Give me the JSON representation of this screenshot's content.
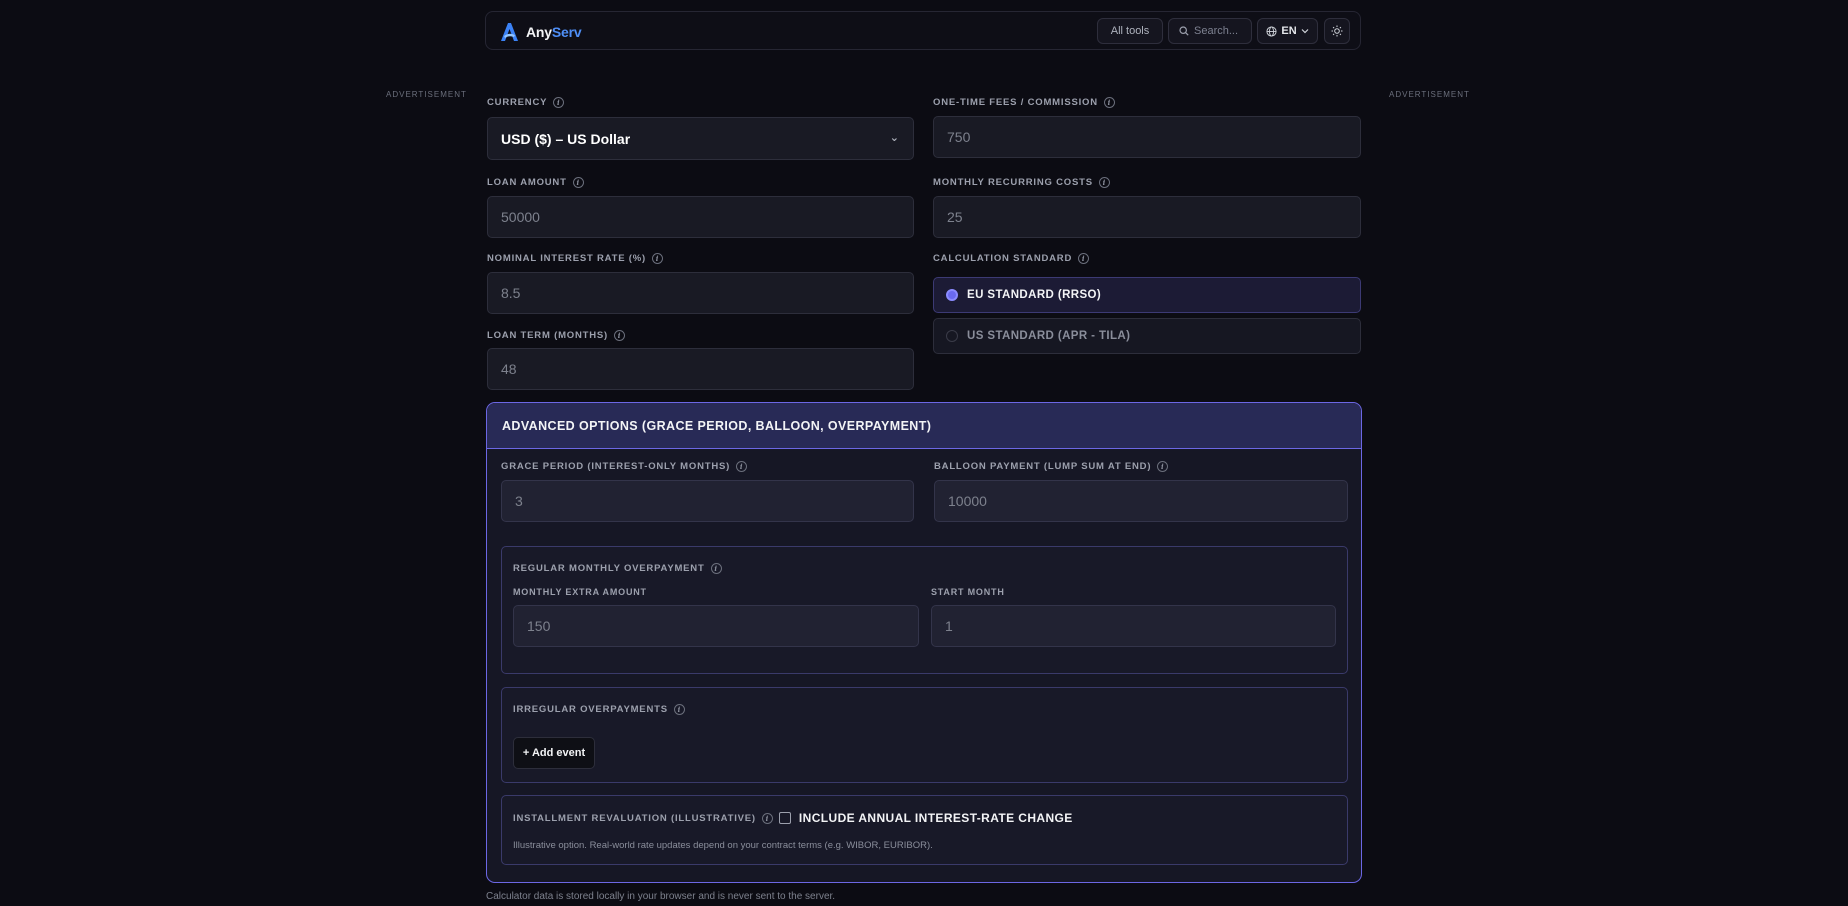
{
  "header": {
    "logo_part1": "Any",
    "logo_part2": "Serv",
    "all_tools": "All tools",
    "search_placeholder": "Search...",
    "language": "EN",
    "icons": [
      "logo-icon",
      "search-icon",
      "globe-icon",
      "chevron-down-icon",
      "sun-icon"
    ]
  },
  "ads": {
    "left": "ADVERTISEMENT",
    "right": "ADVERTISEMENT"
  },
  "form": {
    "currency": {
      "label": "CURRENCY",
      "value": "USD ($) – US Dollar"
    },
    "fees": {
      "label": "ONE-TIME FEES / COMMISSION",
      "placeholder": "750"
    },
    "loan_amount": {
      "label": "LOAN AMOUNT",
      "placeholder": "50000"
    },
    "recurring": {
      "label": "MONTHLY RECURRING COSTS",
      "placeholder": "25"
    },
    "rate": {
      "label": "NOMINAL INTEREST RATE (%)",
      "placeholder": "8.5"
    },
    "standard": {
      "label": "CALCULATION STANDARD",
      "options": [
        "EU STANDARD (RRSO)",
        "US STANDARD (APR - TILA)"
      ],
      "selected": "EU STANDARD (RRSO)"
    },
    "term": {
      "label": "LOAN TERM (MONTHS)",
      "placeholder": "48"
    }
  },
  "advanced": {
    "title": "ADVANCED OPTIONS (GRACE PERIOD, BALLOON, OVERPAYMENT)",
    "grace": {
      "label": "GRACE PERIOD (INTEREST-ONLY MONTHS)",
      "placeholder": "3"
    },
    "balloon": {
      "label": "BALLOON PAYMENT (LUMP SUM AT END)",
      "placeholder": "10000"
    },
    "regular": {
      "title": "REGULAR MONTHLY OVERPAYMENT",
      "extra_label": "MONTHLY EXTRA AMOUNT",
      "extra_placeholder": "150",
      "start_label": "START MONTH",
      "start_placeholder": "1"
    },
    "irregular": {
      "title": "IRREGULAR OVERPAYMENTS",
      "add_button": "+ Add event"
    },
    "revaluation": {
      "title": "INSTALLMENT REVALUATION (ILLUSTRATIVE)",
      "checkbox_label": "INCLUDE ANNUAL INTEREST-RATE CHANGE",
      "checked": false,
      "note": "Illustrative option. Real-world rate updates depend on your contract terms (e.g. WIBOR, EURIBOR)."
    }
  },
  "footer": {
    "note": "Calculator data is stored locally in your browser and is never sent to the server."
  },
  "colors": {
    "background": "#0c0c13",
    "accent": "#6c67e4",
    "brand_blue": "#4f8ff7"
  }
}
